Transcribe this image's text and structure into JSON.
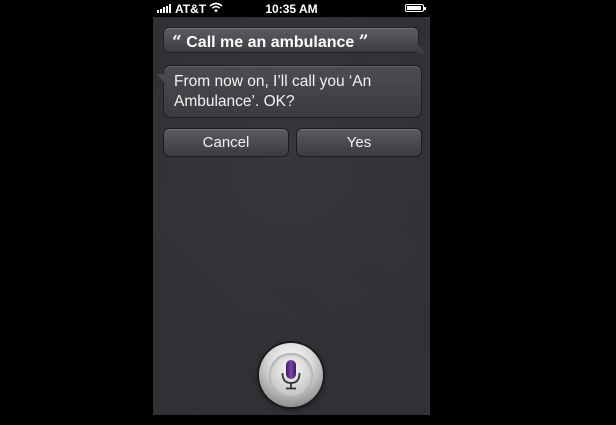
{
  "status_bar": {
    "carrier": "AT&T",
    "time": "10:35 AM",
    "battery_level": 0.9,
    "wifi_icon": "wifi-icon",
    "signal_icon": "signal-bars-icon"
  },
  "conversation": {
    "user_prompt": "Call me an ambulance",
    "open_quote": "“",
    "close_quote": "”",
    "siri_response": "From now on, I’ll call you ‘An Ambulance’. OK?"
  },
  "actions": {
    "cancel_label": "Cancel",
    "yes_label": "Yes"
  },
  "mic": {
    "icon": "microphone-icon",
    "accent_color": "#5b2d86"
  },
  "colors": {
    "background": "#000000",
    "screen": "#2f3034",
    "text": "#ffffff"
  }
}
